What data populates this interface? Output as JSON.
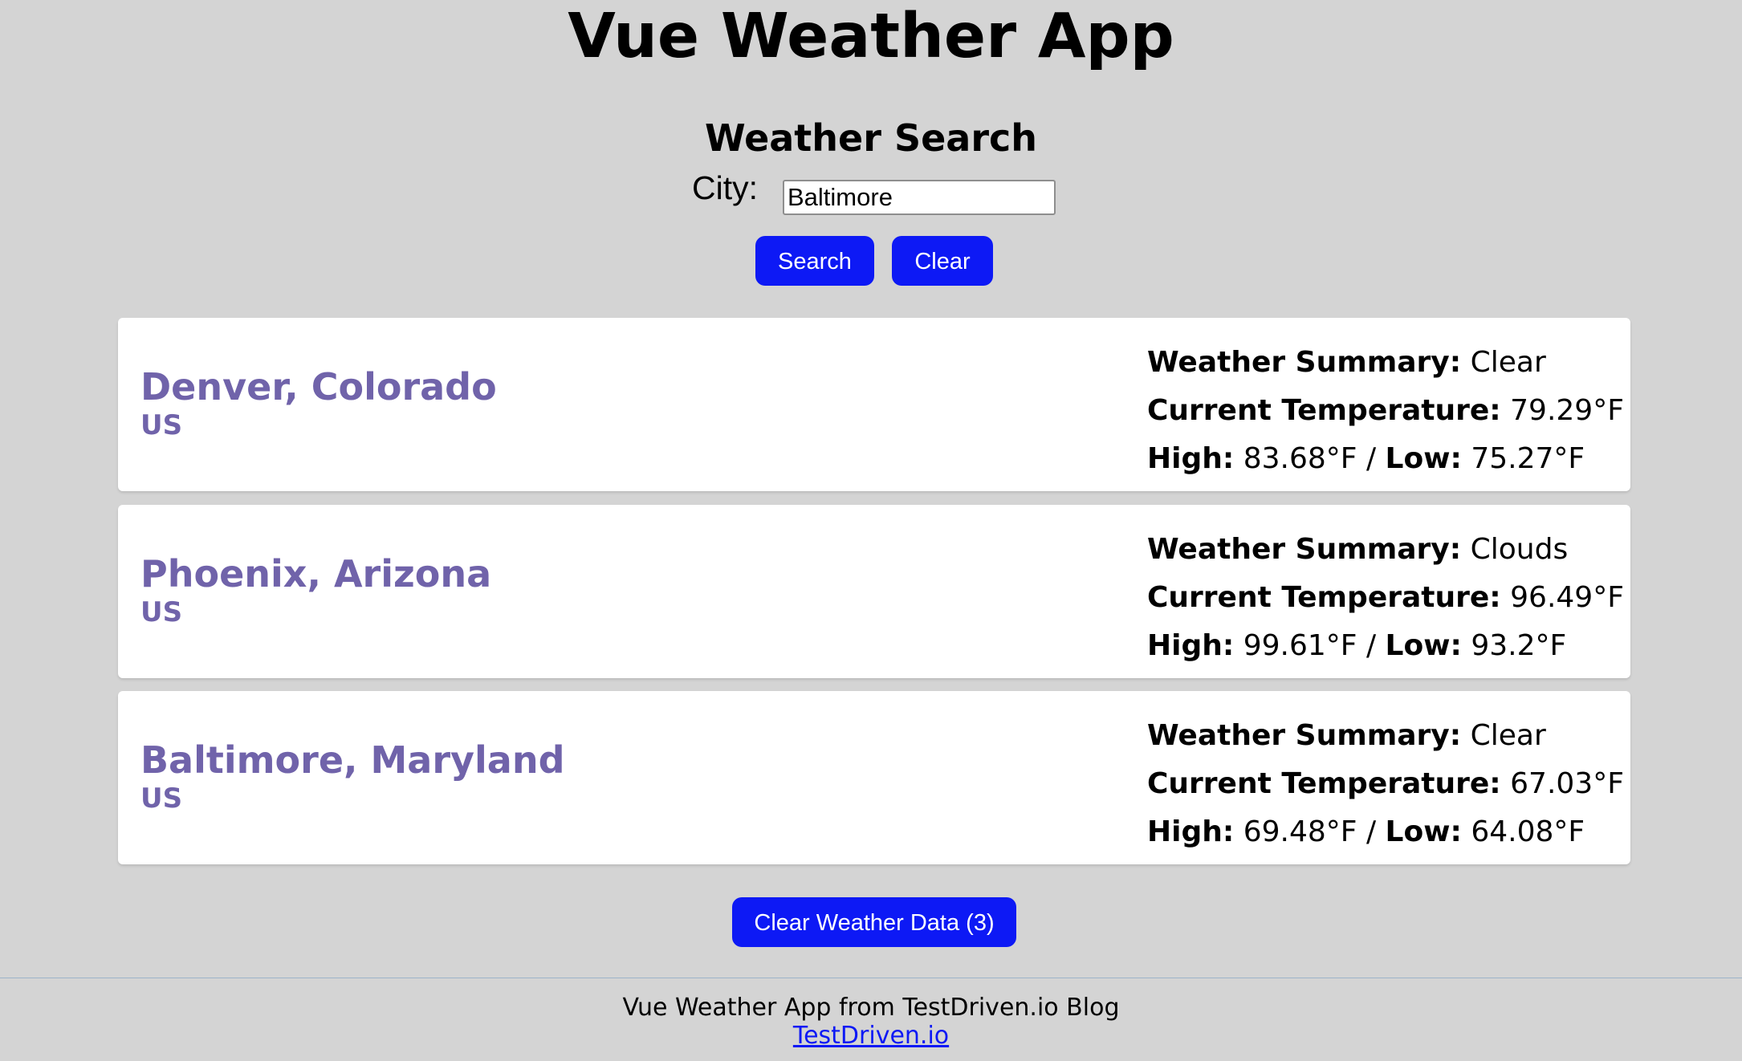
{
  "app": {
    "title": "Vue Weather App"
  },
  "search": {
    "title": "Weather Search",
    "city_label": "City:",
    "city_value": "Baltimore",
    "search_label": "Search",
    "clear_label": "Clear"
  },
  "colors": {
    "page_background": "#d4d4d4",
    "button": "#0d19f5",
    "city_text": "#7063aa",
    "link": "#0d19f5"
  },
  "cards": [
    {
      "city": "Denver, Colorado",
      "country": "US",
      "summary_label": "Weather Summary:",
      "summary": "Clear",
      "temp_label": "Current Temperature:",
      "temp": "79.29°F",
      "high_label": "High:",
      "high": "83.68°F",
      "separator": "/",
      "low_label": "Low:",
      "low": "75.27°F"
    },
    {
      "city": "Phoenix, Arizona",
      "country": "US",
      "summary_label": "Weather Summary:",
      "summary": "Clouds",
      "temp_label": "Current Temperature:",
      "temp": "96.49°F",
      "high_label": "High:",
      "high": "99.61°F",
      "separator": "/",
      "low_label": "Low:",
      "low": "93.2°F"
    },
    {
      "city": "Baltimore, Maryland",
      "country": "US",
      "summary_label": "Weather Summary:",
      "summary": "Clear",
      "temp_label": "Current Temperature:",
      "temp": "67.03°F",
      "high_label": "High:",
      "high": "69.48°F",
      "separator": "/",
      "low_label": "Low:",
      "low": "64.08°F"
    }
  ],
  "actions": {
    "clear_data_label": "Clear Weather Data (3)"
  },
  "footer": {
    "text": "Vue Weather App from TestDriven.io Blog",
    "link_label": "TestDriven.io"
  }
}
